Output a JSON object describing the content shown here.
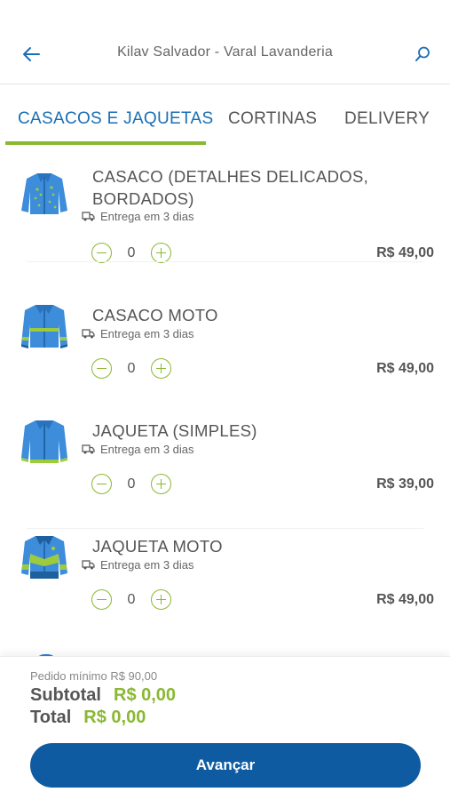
{
  "header": {
    "title": "Kilav Salvador - Varal Lavanderia",
    "back_icon": "arrow-left-icon",
    "search_icon": "search-icon"
  },
  "tabs": [
    {
      "label": "CASACOS E JAQUETAS",
      "active": true
    },
    {
      "label": "CORTINAS",
      "active": false
    },
    {
      "label": "DELIVERY",
      "active": false
    }
  ],
  "items": [
    {
      "name": "CASACO (DETALHES DELICADOS, BORDADOS)",
      "delivery": "Entrega em 3 dias",
      "qty": "0",
      "price": "R$ 49,00",
      "icon": "jacket-icon"
    },
    {
      "name": "CASACO MOTO",
      "delivery": "Entrega em 3 dias",
      "qty": "0",
      "price": "R$ 49,00",
      "icon": "moto-jacket-icon"
    },
    {
      "name": "JAQUETA (SIMPLES)",
      "delivery": "Entrega em 3 dias",
      "qty": "0",
      "price": "R$ 39,00",
      "icon": "jacket-icon"
    },
    {
      "name": "JAQUETA MOTO",
      "delivery": "Entrega em 3 dias",
      "qty": "0",
      "price": "R$ 49,00",
      "icon": "moto-jacket-icon"
    }
  ],
  "footer": {
    "min_order": "Pedido mínimo R$ 90,00",
    "subtotal_label": "Subtotal",
    "subtotal_value": "R$ 0,00",
    "total_label": "Total",
    "total_value": "R$ 0,00",
    "advance_label": "Avançar"
  },
  "colors": {
    "brand_blue": "#1c6eb4",
    "button_blue": "#0f5ba1",
    "accent_green": "#8ab833"
  }
}
